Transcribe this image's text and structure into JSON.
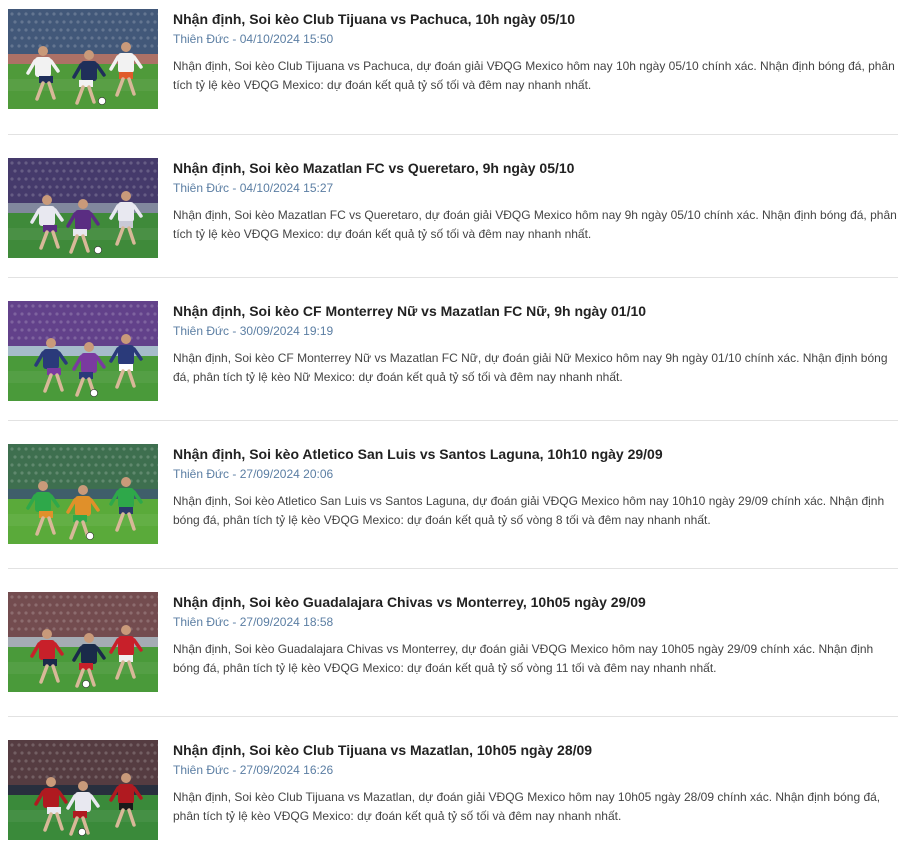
{
  "articles": [
    {
      "title": "Nhận định, Soi kèo Club Tijuana vs Pachuca, 10h ngày 05/10",
      "author": "Thiên Đức",
      "date": "04/10/2024 15:50",
      "excerpt": "Nhận định, Soi kèo Club Tijuana vs Pachuca, dự đoán giải VĐQG Mexico hôm nay 10h ngày 05/10 chính xác. Nhận định bóng đá, phân tích tỷ lệ kèo VĐQG Mexico: dự đoán kết quả tỷ số tối và đêm nay nhanh nhất.",
      "thumb_colors": {
        "sky": "#6f8fb0",
        "stand": "#3b4f70",
        "pitch": "#4f9a3a",
        "kit_a": "#f2f2f2",
        "kit_b": "#1f2f5a",
        "accent": "#e05a2a"
      }
    },
    {
      "title": "Nhận định, Soi kèo Mazatlan FC vs Queretaro, 9h ngày 05/10",
      "author": "Thiên Đức",
      "date": "04/10/2024 15:27",
      "excerpt": "Nhận định, Soi kèo Mazatlan FC vs Queretaro, dự đoán giải VĐQG Mexico hôm nay 9h ngày 05/10 chính xác. Nhận định bóng đá, phân tích tỷ lệ kèo VĐQG Mexico: dự đoán kết quả tỷ số tối và đêm nay nhanh nhất.",
      "thumb_colors": {
        "sky": "#2b3a5a",
        "stand": "#4a3b6e",
        "pitch": "#3f8a3a",
        "kit_a": "#e8e8f0",
        "kit_b": "#5a2d82",
        "accent": "#c9c9d6"
      }
    },
    {
      "title": "Nhận định, Soi kèo CF Monterrey Nữ vs Mazatlan FC Nữ, 9h ngày 01/10",
      "author": "Thiên Đức",
      "date": "30/09/2024 19:19",
      "excerpt": "Nhận định, Soi kèo CF Monterrey Nữ vs Mazatlan FC Nữ, dự đoán giải Nữ Mexico hôm nay 9h ngày 01/10 chính xác. Nhận định bóng đá, phân tích tỷ lệ kèo Nữ Mexico: dự đoán kết quả tỷ số tối và đêm nay nhanh nhất.",
      "thumb_colors": {
        "sky": "#3a6a8a",
        "stand": "#6a3a8a",
        "pitch": "#4a9a3a",
        "kit_a": "#2a3a7a",
        "kit_b": "#7a3aa0",
        "accent": "#ffffff"
      }
    },
    {
      "title": "Nhận định, Soi kèo Atletico San Luis vs Santos Laguna, 10h10 ngày 29/09",
      "author": "Thiên Đức",
      "date": "27/09/2024 20:06",
      "excerpt": "Nhận định, Soi kèo Atletico San Luis vs Santos Laguna, dự đoán giải VĐQG Mexico hôm nay 10h10 ngày 29/09 chính xác. Nhận định bóng đá, phân tích tỷ lệ kèo VĐQG Mexico: dự đoán kết quả tỷ số vòng 8 tối và đêm nay nhanh nhất.",
      "thumb_colors": {
        "sky": "#5a8a6a",
        "stand": "#3a6a4a",
        "pitch": "#5aaa3a",
        "kit_a": "#2ea84a",
        "kit_b": "#e0902a",
        "accent": "#2a3a6a"
      }
    },
    {
      "title": "Nhận định, Soi kèo Guadalajara Chivas vs Monterrey, 10h05 ngày 29/09",
      "author": "Thiên Đức",
      "date": "27/09/2024 18:58",
      "excerpt": "Nhận định, Soi kèo Guadalajara Chivas vs Monterrey, dự đoán giải VĐQG Mexico hôm nay 10h05 ngày 29/09 chính xác. Nhận định bóng đá, phân tích tỷ lệ kèo VĐQG Mexico: dự đoán kết quả tỷ số vòng 11 tối và đêm nay nhanh nhất.",
      "thumb_colors": {
        "sky": "#4a5a6a",
        "stand": "#7a4a4a",
        "pitch": "#4a9a3a",
        "kit_a": "#c8202a",
        "kit_b": "#1a2a4a",
        "accent": "#f0f0f0"
      }
    },
    {
      "title": "Nhận định, Soi kèo Club Tijuana vs Mazatlan, 10h05 ngày 28/09",
      "author": "Thiên Đức",
      "date": "27/09/2024 16:26",
      "excerpt": "Nhận định, Soi kèo Club Tijuana vs Mazatlan, dự đoán giải VĐQG Mexico hôm nay 10h05 ngày 28/09 chính xác. Nhận định bóng đá, phân tích tỷ lệ kèo VĐQG Mexico: dự đoán kết quả tỷ số tối và đêm nay nhanh nhất.",
      "thumb_colors": {
        "sky": "#3a4a6a",
        "stand": "#5a3a3a",
        "pitch": "#3a8a3a",
        "kit_a": "#b01a20",
        "kit_b": "#e8e8f0",
        "accent": "#1a1a1a"
      }
    }
  ]
}
